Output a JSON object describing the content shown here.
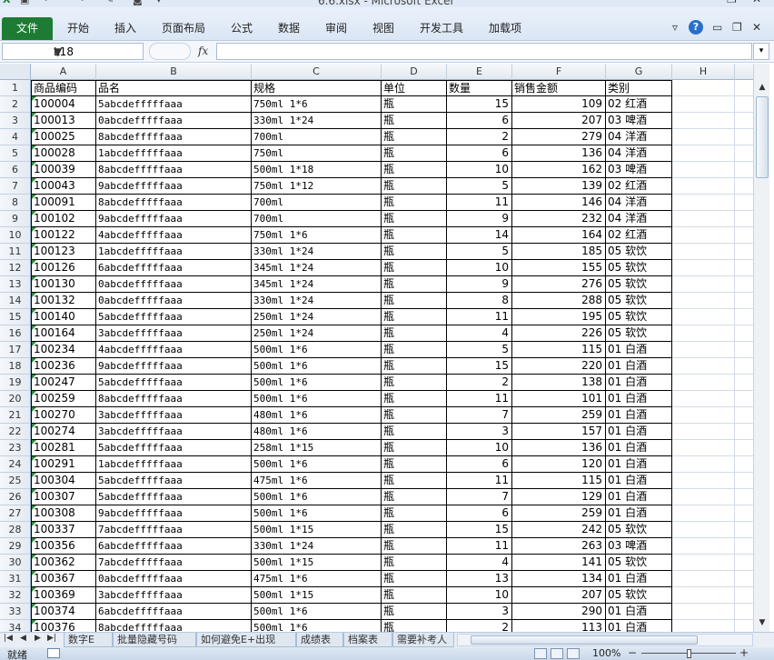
{
  "window": {
    "title": "6.6.xlsx - Microsoft Excel",
    "qat_icons": [
      "excel-app-icon",
      "save-icon",
      "undo-icon",
      "redo-icon",
      "paint-icon",
      "camera-icon",
      "customize-qat-icon"
    ],
    "controls": [
      "minimize-icon",
      "restore-icon",
      "close-icon"
    ]
  },
  "ribbon": {
    "file_tab": "文件",
    "tabs": [
      "开始",
      "插入",
      "页面布局",
      "公式",
      "数据",
      "审阅",
      "视图",
      "开发工具",
      "加载项"
    ]
  },
  "formula_bar": {
    "name_box": "L18",
    "fx": "fx",
    "formula": ""
  },
  "columns": [
    "A",
    "B",
    "C",
    "D",
    "E",
    "F",
    "G",
    "H"
  ],
  "headers": [
    "商品编码",
    "品名",
    "规格",
    "单位",
    "数量",
    "销售金额",
    "类别"
  ],
  "rows": [
    [
      "100004",
      "5abcdefffffaaa",
      "750ml 1*6",
      "瓶",
      "15",
      "109",
      "02 红酒"
    ],
    [
      "100013",
      "0abcdefffffaaa",
      "330ml 1*24",
      "瓶",
      "6",
      "207",
      "03 啤酒"
    ],
    [
      "100025",
      "8abcdefffffaaa",
      "700ml",
      "瓶",
      "2",
      "279",
      "04 洋酒"
    ],
    [
      "100028",
      "1abcdefffffaaa",
      "750ml",
      "瓶",
      "6",
      "136",
      "04 洋酒"
    ],
    [
      "100039",
      "8abcdefffffaaa",
      "500ml 1*18",
      "瓶",
      "10",
      "162",
      "03 啤酒"
    ],
    [
      "100043",
      "9abcdefffffaaa",
      "750ml 1*12",
      "瓶",
      "5",
      "139",
      "02 红酒"
    ],
    [
      "100091",
      "8abcdefffffaaa",
      "700ml",
      "瓶",
      "11",
      "146",
      "04 洋酒"
    ],
    [
      "100102",
      "9abcdefffffaaa",
      "700ml",
      "瓶",
      "9",
      "232",
      "04 洋酒"
    ],
    [
      "100122",
      "4abcdefffffaaa",
      "750ml 1*6",
      "瓶",
      "14",
      "164",
      "02 红酒"
    ],
    [
      "100123",
      "1abcdefffffaaa",
      "330ml 1*24",
      "瓶",
      "5",
      "185",
      "05 软饮"
    ],
    [
      "100126",
      "6abcdefffffaaa",
      "345ml 1*24",
      "瓶",
      "10",
      "155",
      "05 软饮"
    ],
    [
      "100130",
      "0abcdefffffaaa",
      "345ml 1*24",
      "瓶",
      "9",
      "276",
      "05 软饮"
    ],
    [
      "100132",
      "0abcdefffffaaa",
      "330ml 1*24",
      "瓶",
      "8",
      "288",
      "05 软饮"
    ],
    [
      "100140",
      "5abcdefffffaaa",
      "250ml 1*24",
      "瓶",
      "11",
      "195",
      "05 软饮"
    ],
    [
      "100164",
      "3abcdefffffaaa",
      "250ml 1*24",
      "瓶",
      "4",
      "226",
      "05 软饮"
    ],
    [
      "100234",
      "4abcdefffffaaa",
      "500ml 1*6",
      "瓶",
      "5",
      "115",
      "01 白酒"
    ],
    [
      "100236",
      "9abcdefffffaaa",
      "500ml 1*6",
      "瓶",
      "15",
      "220",
      "01 白酒"
    ],
    [
      "100247",
      "5abcdefffffaaa",
      "500ml 1*6",
      "瓶",
      "2",
      "138",
      "01 白酒"
    ],
    [
      "100259",
      "8abcdefffffaaa",
      "500ml 1*6",
      "瓶",
      "11",
      "101",
      "01 白酒"
    ],
    [
      "100270",
      "3abcdefffffaaa",
      "480ml 1*6",
      "瓶",
      "7",
      "259",
      "01 白酒"
    ],
    [
      "100274",
      "3abcdefffffaaa",
      "480ml 1*6",
      "瓶",
      "3",
      "157",
      "01 白酒"
    ],
    [
      "100281",
      "5abcdefffffaaa",
      "258ml 1*15",
      "瓶",
      "10",
      "136",
      "01 白酒"
    ],
    [
      "100291",
      "1abcdefffffaaa",
      "500ml 1*6",
      "瓶",
      "6",
      "120",
      "01 白酒"
    ],
    [
      "100304",
      "5abcdefffffaaa",
      "475ml 1*6",
      "瓶",
      "11",
      "115",
      "01 白酒"
    ],
    [
      "100307",
      "5abcdefffffaaa",
      "500ml 1*6",
      "瓶",
      "7",
      "129",
      "01 白酒"
    ],
    [
      "100308",
      "9abcdefffffaaa",
      "500ml 1*6",
      "瓶",
      "6",
      "259",
      "01 白酒"
    ],
    [
      "100337",
      "7abcdefffffaaa",
      "500ml 1*15",
      "瓶",
      "15",
      "242",
      "05 软饮"
    ],
    [
      "100356",
      "6abcdefffffaaa",
      "330ml 1*24",
      "瓶",
      "11",
      "263",
      "03 啤酒"
    ],
    [
      "100362",
      "7abcdefffffaaa",
      "500ml 1*15",
      "瓶",
      "4",
      "141",
      "05 软饮"
    ],
    [
      "100367",
      "0abcdefffffaaa",
      "475ml 1*6",
      "瓶",
      "13",
      "134",
      "01 白酒"
    ],
    [
      "100369",
      "3abcdefffffaaa",
      "500ml 1*15",
      "瓶",
      "10",
      "207",
      "05 软饮"
    ],
    [
      "100374",
      "6abcdefffffaaa",
      "500ml 1*6",
      "瓶",
      "3",
      "290",
      "01 白酒"
    ],
    [
      "100376",
      "8abcdefffffaaa",
      "500ml 1*6",
      "瓶",
      "2",
      "113",
      "01 白酒"
    ]
  ],
  "sheet_tabs": [
    "数字E",
    "批量隐藏号码",
    "如何避免E+出现",
    "成绩表",
    "档案表",
    "需要补考人"
  ],
  "status": {
    "ready": "就绪",
    "zoom": "100%",
    "view_modes": [
      "normal-view-icon",
      "page-layout-icon",
      "page-break-icon"
    ]
  }
}
